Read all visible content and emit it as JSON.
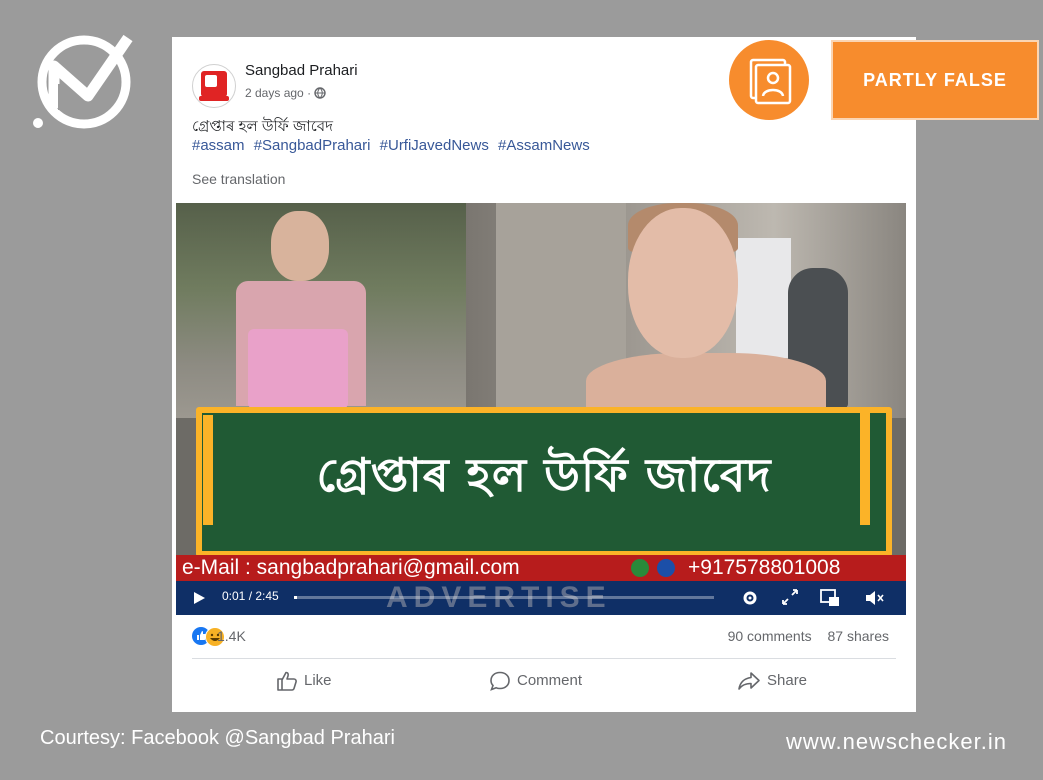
{
  "badge": {
    "verdict": "PARTLY FALSE"
  },
  "post": {
    "page_name": "Sangbad Prahari",
    "time_ago": "2 days ago",
    "meta_separator": "·",
    "title": "গ্ৰেপ্তাৰ হল উৰ্ফি জাবেদ",
    "hashtags": [
      "#assam",
      "#SangbadPrahari",
      "#UrfiJavedNews",
      "#AssamNews"
    ],
    "see_translation": "See translation"
  },
  "video": {
    "banner_text": "গ্ৰেপ্তাৰ হল উৰ্ফি জাবেদ",
    "email": "e-Mail : sangbadprahari@gmail.com",
    "phone": "+917578801008",
    "ad_text": "ADVERTISE",
    "time": "0:01 / 2:45",
    "progress": 0.006
  },
  "engagement": {
    "reactions": "1.4K",
    "comments": "90 comments",
    "shares": "87 shares"
  },
  "actions": {
    "like": "Like",
    "comment": "Comment",
    "share": "Share"
  },
  "footer": {
    "courtesy": "Courtesy: Facebook @Sangbad Prahari",
    "site": "www.newschecker.in"
  },
  "colors": {
    "brand_orange": "#f78c2d",
    "fb_link": "#385898",
    "banner_green": "#205a34",
    "ticker_red": "#b71c1c"
  }
}
